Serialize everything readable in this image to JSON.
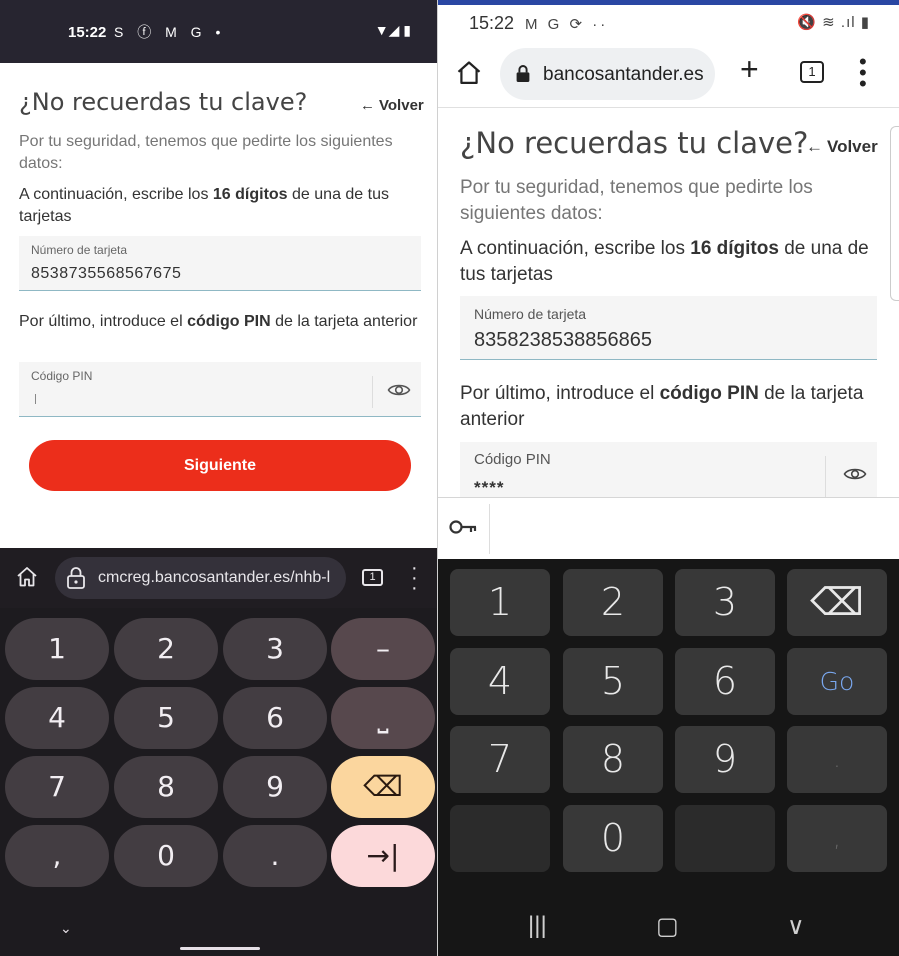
{
  "left": {
    "status": {
      "time": "15:22",
      "notif_icons": "S ⓕ M G •",
      "sys_icons": "▼◢ ▮"
    },
    "form": {
      "title": "¿No recuerdas tu clave?",
      "back_arrow": "←",
      "back_label": "Volver",
      "intro": "Por tu seguridad, tenemos que pedirte los siguientes datos:",
      "step1_pre": "A continuación, escribe los ",
      "step1_bold": "16 dígitos",
      "step1_post": " de una de tus tarjetas",
      "card_label": "Número de tarjeta",
      "card_value": "8538735568567675",
      "step2_pre": "Por último, introduce el ",
      "step2_bold": "código PIN",
      "step2_post": " de la tarjeta anterior",
      "pin_label": "Código PIN",
      "submit_label": "Siguiente"
    },
    "browser": {
      "url": "cmcreg.bancosantander.es/nhb-l",
      "tab_count": "1"
    },
    "keyboard": {
      "keys": [
        [
          "1",
          "2",
          "3",
          "–"
        ],
        [
          "4",
          "5",
          "6",
          "⎵"
        ],
        [
          "7",
          "8",
          "9",
          "⌫"
        ],
        [
          ",",
          "0",
          ".",
          "→|"
        ]
      ],
      "collapse": "⌄"
    },
    "colors": {
      "brand_red": "#ec2e1b",
      "delete_key": "#fbd69e",
      "next_key": "#fcd9da"
    }
  },
  "right": {
    "status": {
      "time": "15:22",
      "notif_icons": "M G ⟳ ··",
      "sys_icons": "🔇 ≋ .ıl ▮"
    },
    "browser": {
      "url": "bancosantander.es",
      "new_tab": "+",
      "tab_count": "1"
    },
    "form": {
      "title": "¿No recuerdas tu clave?",
      "back_arrow": "←",
      "back_label": "Volver",
      "intro": "Por tu seguridad, tenemos que pedirte los siguientes datos:",
      "step1_pre": "A continuación, escribe los ",
      "step1_bold": "16 dígitos",
      "step1_post": " de una de tus tarjetas",
      "card_label": "Número de tarjeta",
      "card_value": "8358238538856865",
      "step2_pre": "Por último, introduce el ",
      "step2_bold": "código PIN",
      "step2_post": " de la tarjeta anterior",
      "pin_label": "Código PIN",
      "pin_value": "****"
    },
    "keyboard": {
      "keys": [
        [
          "1",
          "2",
          "3",
          "⌫"
        ],
        [
          "4",
          "5",
          "6",
          "Go"
        ],
        [
          "7",
          "8",
          "9",
          "."
        ],
        [
          "",
          "0",
          "",
          ","
        ]
      ]
    },
    "nav": {
      "recents": "|||",
      "home": "▢",
      "back": "∨"
    },
    "colors": {
      "top_accent": "#2a47a3",
      "go_key": "#7aa8f0"
    }
  }
}
